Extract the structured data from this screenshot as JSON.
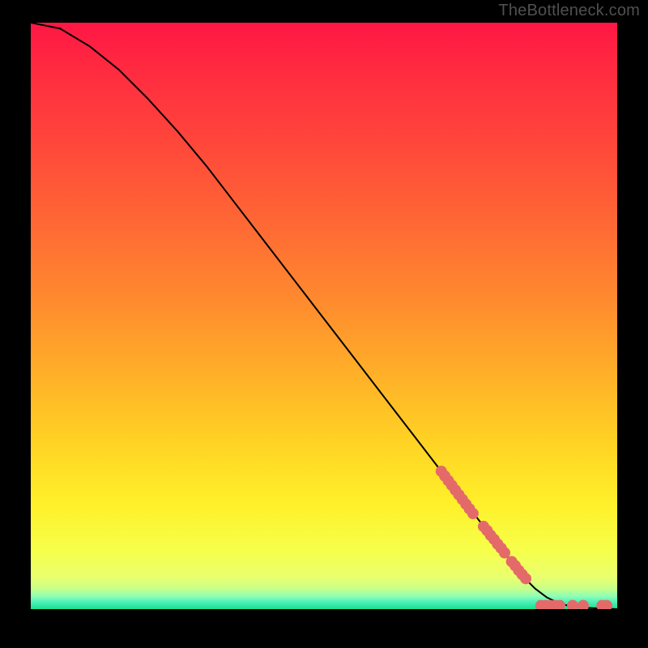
{
  "watermark": "TheBottleneck.com",
  "chart_data": {
    "type": "line",
    "title": "",
    "xlabel": "",
    "ylabel": "",
    "xlim": [
      0,
      100
    ],
    "ylim": [
      0,
      100
    ],
    "curve": [
      {
        "x": 0,
        "y": 100
      },
      {
        "x": 5,
        "y": 99
      },
      {
        "x": 10,
        "y": 96
      },
      {
        "x": 15,
        "y": 92
      },
      {
        "x": 20,
        "y": 87
      },
      {
        "x": 25,
        "y": 81.5
      },
      {
        "x": 30,
        "y": 75.5
      },
      {
        "x": 35,
        "y": 69
      },
      {
        "x": 40,
        "y": 62.5
      },
      {
        "x": 45,
        "y": 56
      },
      {
        "x": 50,
        "y": 49.5
      },
      {
        "x": 55,
        "y": 43
      },
      {
        "x": 60,
        "y": 36.5
      },
      {
        "x": 65,
        "y": 30
      },
      {
        "x": 70,
        "y": 23.5
      },
      {
        "x": 75,
        "y": 17
      },
      {
        "x": 80,
        "y": 10.5
      },
      {
        "x": 82,
        "y": 8
      },
      {
        "x": 84,
        "y": 5.5
      },
      {
        "x": 86,
        "y": 3.5
      },
      {
        "x": 88,
        "y": 2
      },
      {
        "x": 90,
        "y": 1
      },
      {
        "x": 92,
        "y": 0.5
      },
      {
        "x": 95,
        "y": 0.2
      },
      {
        "x": 100,
        "y": 0
      }
    ],
    "series": [
      {
        "name": "cluster-upper",
        "color": "#e46a6a",
        "type": "scatter",
        "points": [
          {
            "x": 70.0,
            "y": 23.5
          },
          {
            "x": 70.6,
            "y": 22.7
          },
          {
            "x": 71.2,
            "y": 21.9
          },
          {
            "x": 71.8,
            "y": 21.1
          },
          {
            "x": 72.4,
            "y": 20.3
          },
          {
            "x": 73.0,
            "y": 19.5
          },
          {
            "x": 73.6,
            "y": 18.7
          },
          {
            "x": 74.2,
            "y": 17.9
          },
          {
            "x": 74.8,
            "y": 17.1
          },
          {
            "x": 75.4,
            "y": 16.3
          }
        ]
      },
      {
        "name": "cluster-middle",
        "color": "#e46a6a",
        "type": "scatter",
        "points": [
          {
            "x": 77.2,
            "y": 14.1
          },
          {
            "x": 77.8,
            "y": 13.4
          },
          {
            "x": 78.4,
            "y": 12.6
          },
          {
            "x": 79.0,
            "y": 11.9
          },
          {
            "x": 79.6,
            "y": 11.1
          },
          {
            "x": 80.2,
            "y": 10.4
          },
          {
            "x": 80.8,
            "y": 9.6
          }
        ]
      },
      {
        "name": "cluster-lower",
        "color": "#e46a6a",
        "type": "scatter",
        "points": [
          {
            "x": 82.0,
            "y": 8.1
          },
          {
            "x": 82.6,
            "y": 7.4
          },
          {
            "x": 83.2,
            "y": 6.6
          },
          {
            "x": 83.8,
            "y": 5.9
          },
          {
            "x": 84.4,
            "y": 5.2
          }
        ]
      },
      {
        "name": "cluster-tail",
        "color": "#e46a6a",
        "type": "scatter",
        "points": [
          {
            "x": 87.0,
            "y": 0.6
          },
          {
            "x": 87.8,
            "y": 0.6
          },
          {
            "x": 88.6,
            "y": 0.6
          },
          {
            "x": 89.4,
            "y": 0.6
          },
          {
            "x": 90.2,
            "y": 0.6
          },
          {
            "x": 92.4,
            "y": 0.6
          },
          {
            "x": 94.2,
            "y": 0.6
          },
          {
            "x": 97.4,
            "y": 0.6
          },
          {
            "x": 98.2,
            "y": 0.6
          }
        ]
      }
    ],
    "background_gradient": {
      "stops": [
        {
          "offset": 0.0,
          "color": "#ff1744"
        },
        {
          "offset": 0.1,
          "color": "#ff2f3f"
        },
        {
          "offset": 0.22,
          "color": "#ff4a3a"
        },
        {
          "offset": 0.35,
          "color": "#ff6a34"
        },
        {
          "offset": 0.48,
          "color": "#ff8c2e"
        },
        {
          "offset": 0.6,
          "color": "#ffb028"
        },
        {
          "offset": 0.72,
          "color": "#ffd424"
        },
        {
          "offset": 0.82,
          "color": "#fff02a"
        },
        {
          "offset": 0.9,
          "color": "#f6ff4a"
        },
        {
          "offset": 0.945,
          "color": "#eaff6e"
        },
        {
          "offset": 0.965,
          "color": "#c8ff8a"
        },
        {
          "offset": 0.978,
          "color": "#8dffb4"
        },
        {
          "offset": 0.988,
          "color": "#4cf0b8"
        },
        {
          "offset": 1.0,
          "color": "#18e08e"
        }
      ]
    }
  }
}
